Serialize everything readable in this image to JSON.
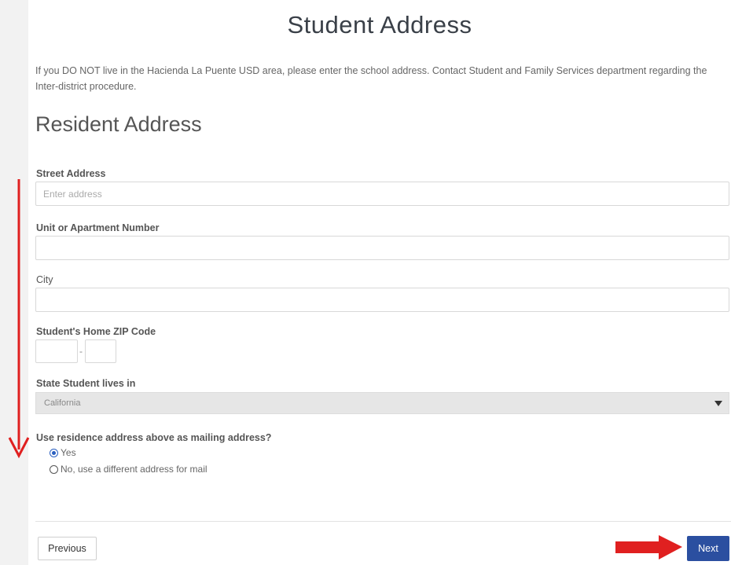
{
  "page": {
    "title": "Student Address",
    "intro": "If you DO NOT live in the Hacienda La Puente USD area, please enter the school address. Contact Student and Family Services department regarding the Inter-district procedure.",
    "section_title": "Resident Address"
  },
  "form": {
    "street": {
      "label": "Street Address",
      "placeholder": "Enter address",
      "value": ""
    },
    "unit": {
      "label": "Unit or Apartment Number",
      "value": ""
    },
    "city": {
      "label": "City",
      "value": ""
    },
    "zip": {
      "label": "Student's Home ZIP Code",
      "dash": "-",
      "value1": "",
      "value2": ""
    },
    "state": {
      "label": "State Student lives in",
      "selected": "California"
    },
    "mailing": {
      "question": "Use residence address above as mailing address?",
      "options": [
        {
          "label": "Yes",
          "checked": true
        },
        {
          "label": "No, use a different address for mail",
          "checked": false
        }
      ]
    }
  },
  "nav": {
    "previous_label": "Previous",
    "next_label": "Next"
  },
  "colors": {
    "primary": "#2b4fa0",
    "annotation_arrow": "#e02020"
  }
}
